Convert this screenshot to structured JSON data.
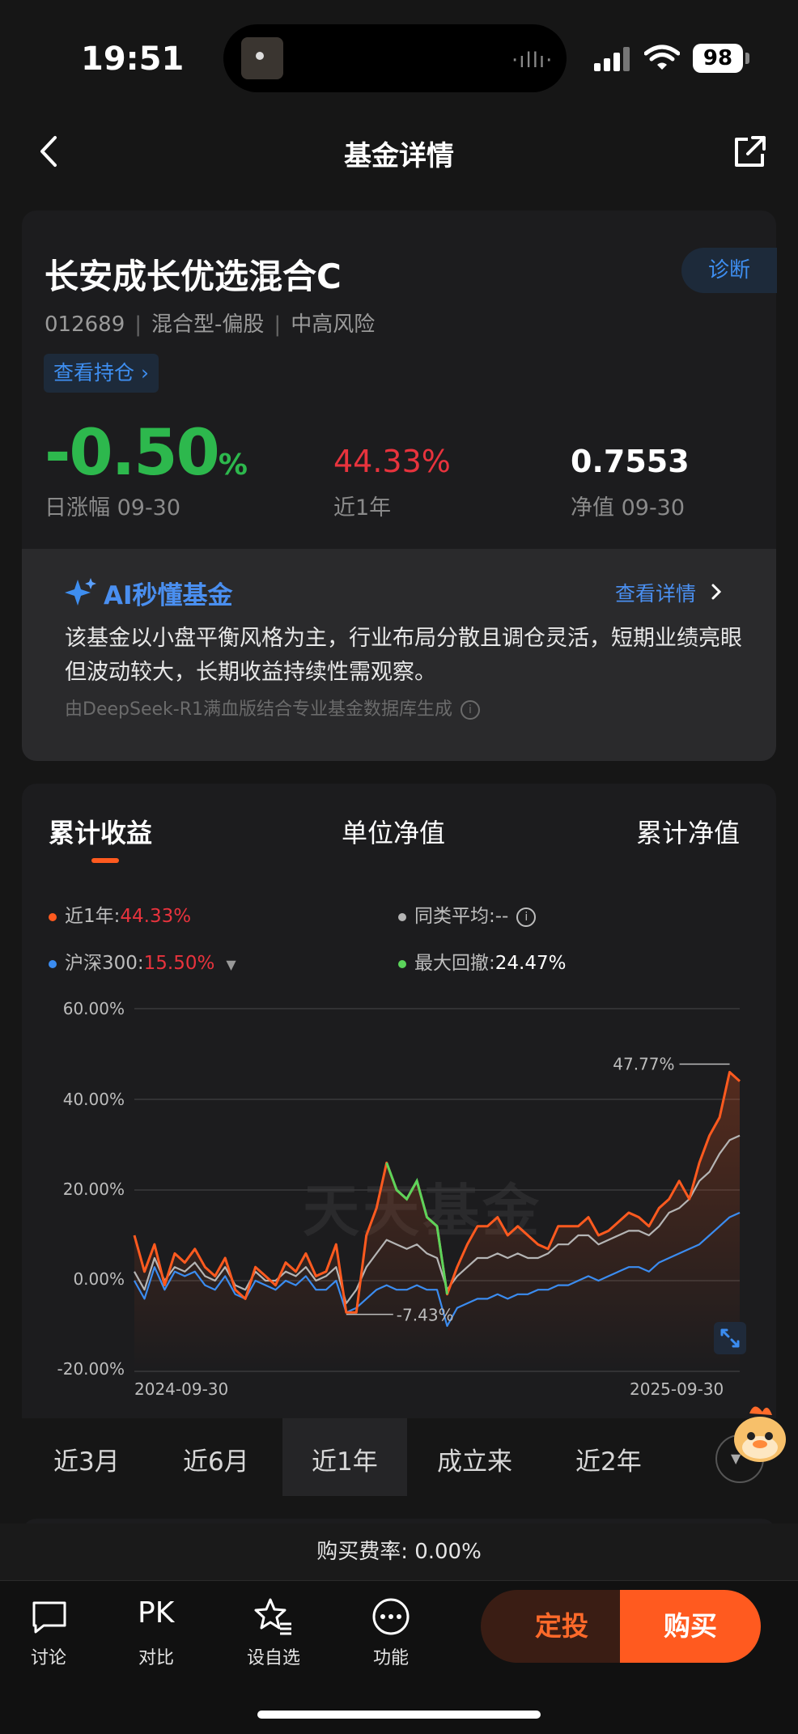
{
  "status_bar": {
    "time": "19:51",
    "battery": "98"
  },
  "nav": {
    "title": "基金详情"
  },
  "fund": {
    "name": "长安成长优选混合C",
    "code": "012689",
    "type": "混合型-偏股",
    "risk": "中高风险",
    "diagnose_label": "诊断",
    "holdings_label": "查看持仓 ›",
    "daily_change": "-0.50",
    "daily_change_unit": "%",
    "daily_change_label": "日涨幅 09-30",
    "one_year_return": "44.33%",
    "one_year_label": "近1年",
    "nav_value": "0.7553",
    "nav_label": "净值 09-30"
  },
  "ai": {
    "title": "AI秒懂基金",
    "link": "查看详情",
    "text": "该基金以小盘平衡风格为主，行业布局分散且调仓灵活，短期业绩亮眼但波动较大，长期收益持续性需观察。",
    "source": "由DeepSeek-R1满血版结合专业基金数据库生成"
  },
  "chart_tabs": [
    "累计收益",
    "单位净值",
    "累计净值"
  ],
  "legend": {
    "fund_label": "近1年:",
    "fund_value": "44.33%",
    "peer_label": "同类平均:",
    "peer_value": "--",
    "index_label": "沪深300:",
    "index_value": "15.50%",
    "dd_label": "最大回撤:",
    "dd_value": "24.47%"
  },
  "watermark": "天天基金",
  "chart_data": {
    "type": "line",
    "x_start": "2024-09-30",
    "x_end": "2025-09-30",
    "ylim": [
      -20,
      60
    ],
    "yticks": [
      "60.00%",
      "40.00%",
      "20.00%",
      "0.00%",
      "-20.00%"
    ],
    "annotations": {
      "max": "47.77%",
      "min": "-7.43%"
    },
    "colors": {
      "fund": "#ff5a1f",
      "peer": "#b5b5b5",
      "index": "#3b8cf0",
      "drawdown": "#5bd45b"
    },
    "series": [
      {
        "name": "近1年",
        "values": [
          10,
          2,
          8,
          -1,
          6,
          4,
          7,
          3,
          1,
          5,
          -2,
          -4,
          3,
          1,
          -1,
          4,
          2,
          6,
          1,
          2,
          8,
          -7,
          -7,
          10,
          16,
          26,
          20,
          18,
          22,
          14,
          12,
          -3,
          3,
          8,
          12,
          12,
          14,
          10,
          12,
          10,
          8,
          7,
          12,
          12,
          12,
          14,
          10,
          11,
          13,
          15,
          14,
          12,
          16,
          18,
          22,
          18,
          26,
          32,
          36,
          46,
          44
        ]
      },
      {
        "name": "同类平均",
        "values": [
          2,
          -2,
          5,
          0,
          3,
          2,
          4,
          1,
          0,
          3,
          -1,
          -2,
          2,
          0,
          0,
          2,
          1,
          3,
          0,
          1,
          3,
          -5,
          -2,
          3,
          6,
          9,
          8,
          7,
          8,
          6,
          5,
          -2,
          1,
          3,
          5,
          5,
          6,
          5,
          6,
          5,
          5,
          6,
          8,
          8,
          10,
          10,
          8,
          9,
          10,
          11,
          11,
          10,
          12,
          15,
          16,
          18,
          22,
          24,
          28,
          31,
          32
        ]
      },
      {
        "name": "沪深300",
        "values": [
          0,
          -4,
          3,
          -2,
          2,
          1,
          2,
          -1,
          -2,
          1,
          -3,
          -4,
          0,
          -1,
          -2,
          0,
          -1,
          1,
          -2,
          -2,
          0,
          -7,
          -6,
          -4,
          -2,
          -1,
          -2,
          -2,
          -1,
          -2,
          -2,
          -10,
          -6,
          -5,
          -4,
          -4,
          -3,
          -4,
          -3,
          -3,
          -2,
          -2,
          -1,
          -1,
          0,
          1,
          0,
          1,
          2,
          3,
          3,
          2,
          4,
          5,
          6,
          7,
          8,
          10,
          12,
          14,
          15
        ]
      }
    ]
  },
  "periods": [
    "近3月",
    "近6月",
    "近1年",
    "成立来",
    "近2年"
  ],
  "fee_text": "购买费率: 0.00%",
  "bottom": {
    "discuss": "讨论",
    "compare_icon": "PK",
    "compare": "对比",
    "watch": "设自选",
    "func": "功能",
    "dingtou": "定投",
    "buy": "购买"
  }
}
